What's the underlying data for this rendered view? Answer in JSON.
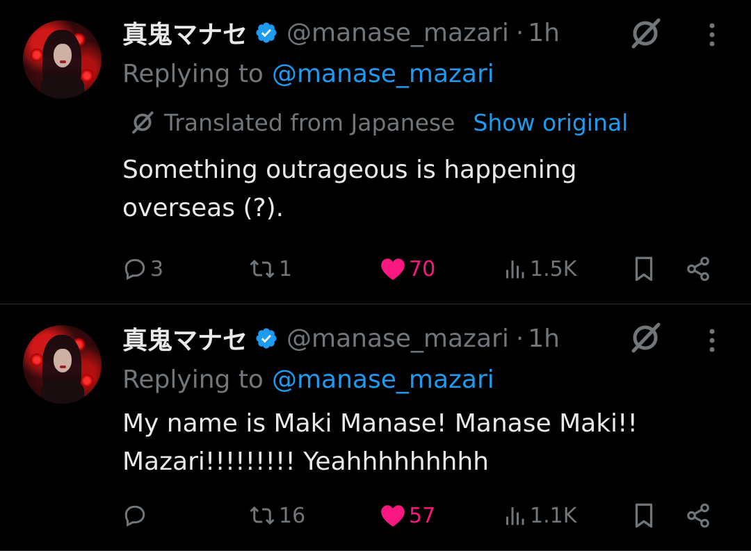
{
  "tweets": [
    {
      "name": "真鬼マナセ",
      "handle": "@manase_mazari",
      "separator": "·",
      "time": "1h",
      "replying_label": "Replying to",
      "replying_handle": "@manase_mazari",
      "translated_label": "Translated from Japanese",
      "show_original": "Show original",
      "text_lines": [
        "Something outrageous is happening",
        "overseas (?)."
      ],
      "replies": "3",
      "reposts": "1",
      "likes": "70",
      "views": "1.5K"
    },
    {
      "name": "真鬼マナセ",
      "handle": "@manase_mazari",
      "separator": "·",
      "time": "1h",
      "replying_label": "Replying to",
      "replying_handle": "@manase_mazari",
      "text_lines": [
        "My name is Maki Manase! Manase Maki!!",
        "Mazari!!!!!!!!!  Yeahhhhhhhhh"
      ],
      "replies": "",
      "reposts": "16",
      "likes": "57",
      "views": "1.1K"
    }
  ],
  "colors": {
    "background": "#000000",
    "text": "#e7e9ea",
    "secondary": "#71767b",
    "link": "#1d9bf0",
    "like": "#f91880",
    "divider": "#2f3336"
  },
  "icons": [
    "verified-badge-icon",
    "grok-icon",
    "more-icon",
    "translate-icon",
    "reply-icon",
    "repost-icon",
    "heart-icon",
    "views-icon",
    "bookmark-icon",
    "share-icon"
  ]
}
